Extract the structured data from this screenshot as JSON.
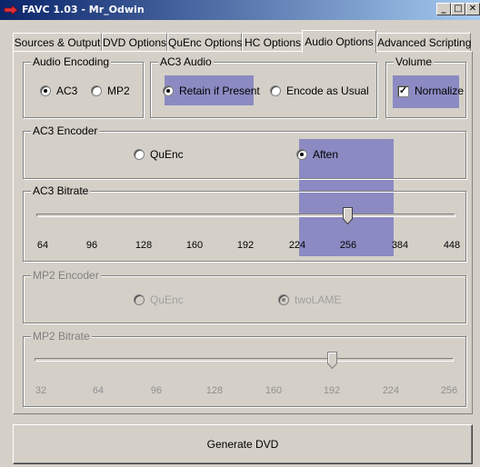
{
  "window": {
    "title": "FAVC 1.03 - Mr_Odwin",
    "minimize": "_",
    "maximize": "□",
    "close": "✕"
  },
  "tabs": [
    {
      "label": "Sources & Output"
    },
    {
      "label": "DVD Options"
    },
    {
      "label": "QuEnc Options"
    },
    {
      "label": "HC Options"
    },
    {
      "label": "Audio Options",
      "active": true
    },
    {
      "label": "Advanced Scripting"
    }
  ],
  "audio_encoding": {
    "title": "Audio Encoding",
    "options": [
      {
        "label": "AC3",
        "selected": true
      },
      {
        "label": "MP2",
        "selected": false
      }
    ]
  },
  "ac3_audio": {
    "title": "AC3 Audio",
    "options": [
      {
        "label": "Retain if Present",
        "selected": true
      },
      {
        "label": "Encode as Usual",
        "selected": false
      }
    ]
  },
  "volume": {
    "title": "Volume",
    "normalize_label": "Normalize",
    "normalize_checked": true
  },
  "ac3_encoder": {
    "title": "AC3 Encoder",
    "options": [
      {
        "label": "QuEnc",
        "selected": false
      },
      {
        "label": "Aften",
        "selected": true
      }
    ]
  },
  "ac3_bitrate": {
    "title": "AC3 Bitrate",
    "ticks": [
      "64",
      "96",
      "128",
      "160",
      "192",
      "224",
      "256",
      "384",
      "448"
    ],
    "value": "256"
  },
  "mp2_encoder": {
    "title": "MP2 Encoder",
    "options": [
      {
        "label": "QuEnc",
        "selected": false
      },
      {
        "label": "twoLAME",
        "selected": true
      }
    ]
  },
  "mp2_bitrate": {
    "title": "MP2 Bitrate",
    "ticks": [
      "32",
      "64",
      "96",
      "128",
      "160",
      "192",
      "224",
      "256"
    ],
    "value": "192"
  },
  "generate_button": "Generate DVD",
  "colors": {
    "highlight": "#5050be",
    "titlebar_start": "#0a246a",
    "titlebar_end": "#a6caf0",
    "face": "#d4d0c8"
  }
}
